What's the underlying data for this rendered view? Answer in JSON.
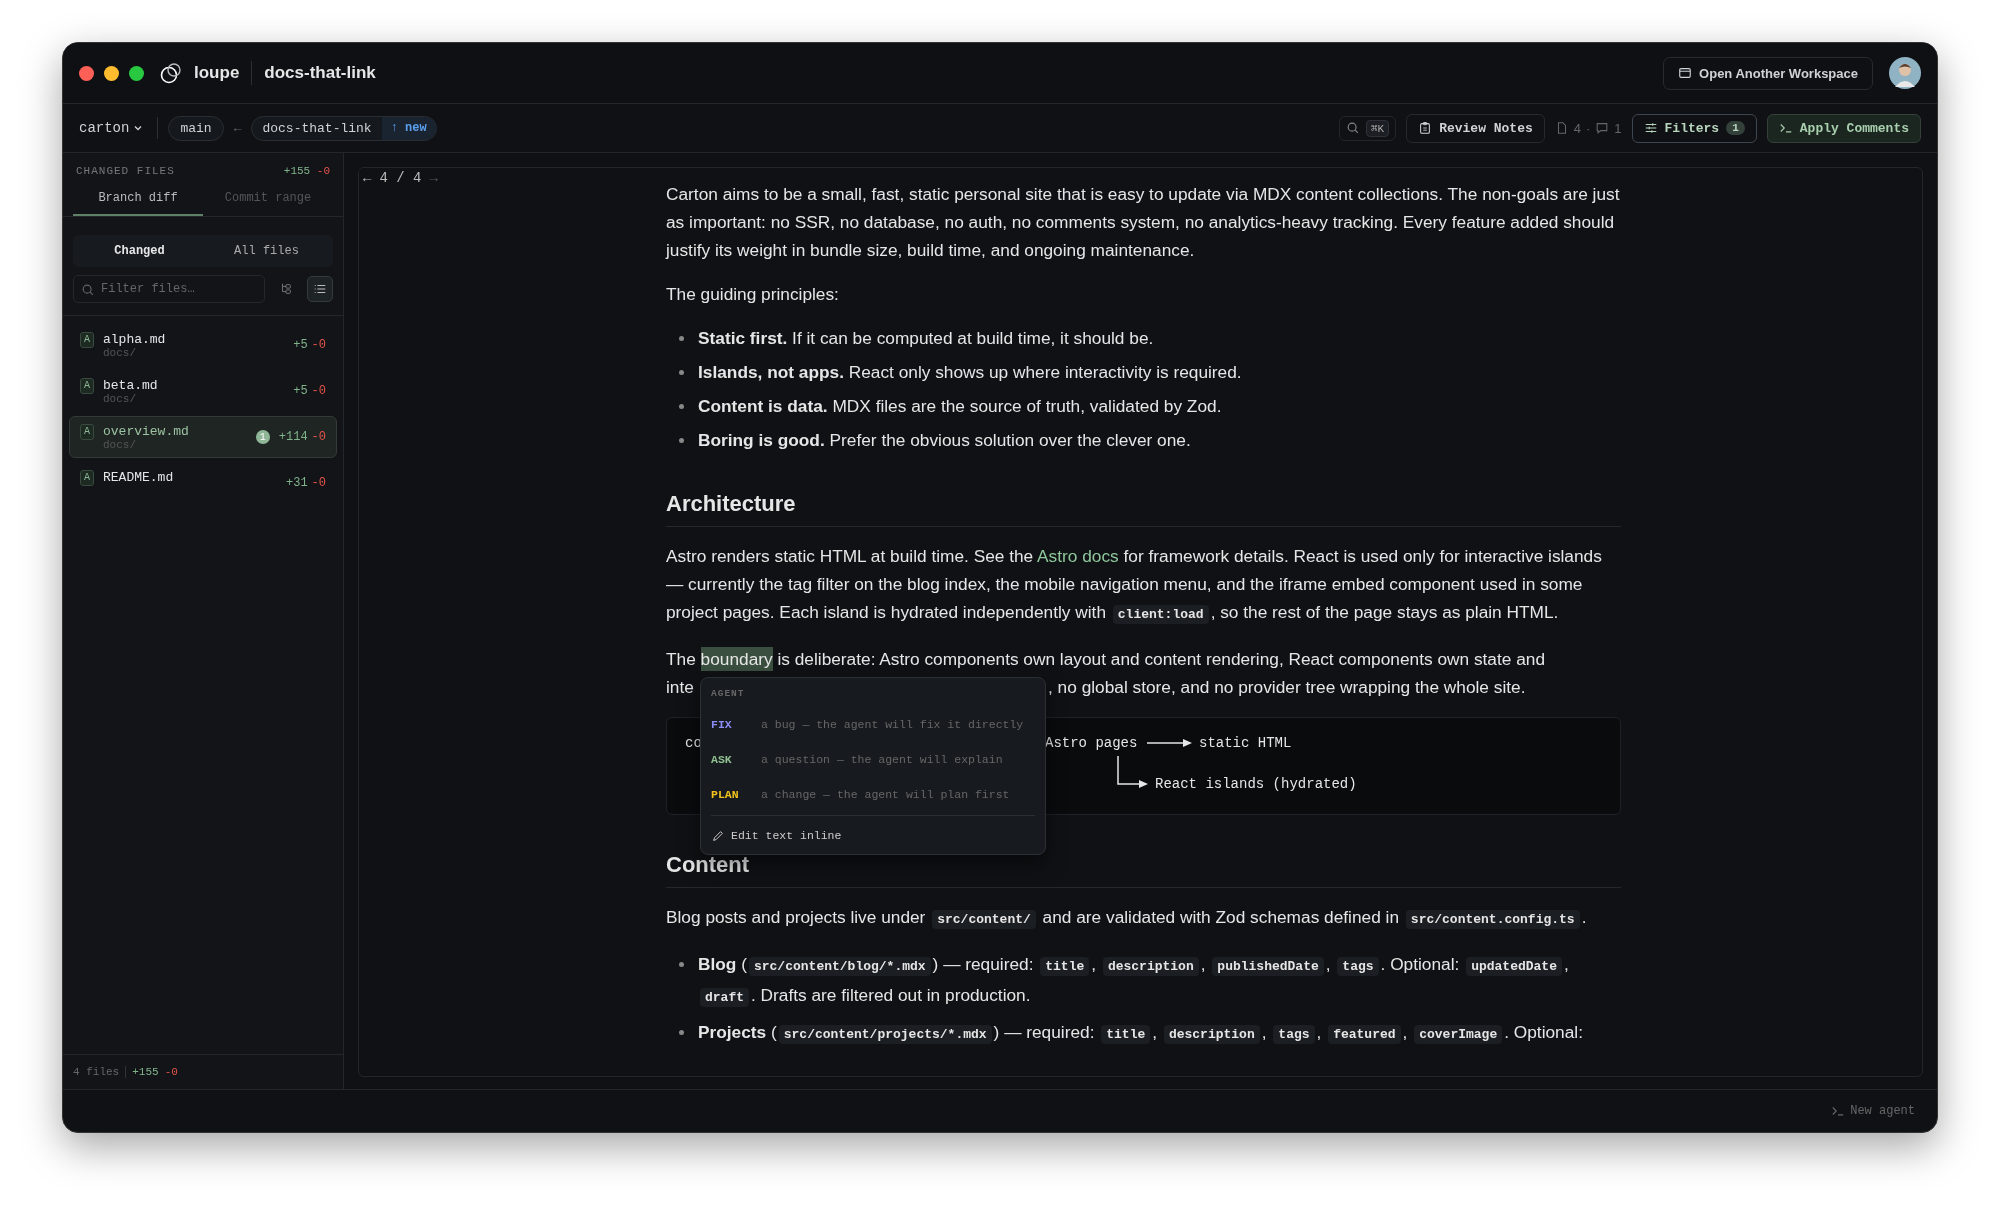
{
  "window": {
    "app_name": "loupe",
    "title": "docs-that-link",
    "open_workspace_button": "Open Another Workspace"
  },
  "toolbar": {
    "repo": "carton",
    "base_branch": "main",
    "arrow": "←",
    "branch": "docs-that-link",
    "branch_badge": "↑ new",
    "shortcut": "⌘K",
    "review_notes": "Review Notes",
    "file_count": "4",
    "separator": "·",
    "comment_count": "1",
    "filters": "Filters",
    "filters_count": "1",
    "apply": "Apply Comments"
  },
  "sidebar": {
    "heading": "CHANGED FILES",
    "added": "+155",
    "removed": "-0",
    "tabs": [
      {
        "label": "Branch diff",
        "selected": true
      },
      {
        "label": "Commit range",
        "selected": false
      }
    ],
    "segments": [
      {
        "label": "Changed",
        "selected": true
      },
      {
        "label": "All files",
        "selected": false
      }
    ],
    "filter_placeholder": "Filter files…",
    "files": [
      {
        "status": "A",
        "name": "alpha.md",
        "dir": "docs/",
        "added": "+5",
        "removed": "-0",
        "selected": false
      },
      {
        "status": "A",
        "name": "beta.md",
        "dir": "docs/",
        "added": "+5",
        "removed": "-0",
        "selected": false
      },
      {
        "status": "A",
        "name": "overview.md",
        "dir": "docs/",
        "comments": "1",
        "added": "+114",
        "removed": "-0",
        "selected": true
      },
      {
        "status": "A",
        "name": "README.md",
        "added": "+31",
        "removed": "-0",
        "selected": false
      }
    ],
    "footer": {
      "count": "4 files",
      "added": "+155",
      "removed": "-0"
    }
  },
  "pager": {
    "prev": "←",
    "position": "4 / 4",
    "next": "→"
  },
  "document": [
    {
      "kind": "paragraph",
      "runs": [
        {
          "kind": "text",
          "text": "Carton aims to be a small, fast, static personal site that is easy to update via MDX content collections. The non-goals are just as important: no SSR, no database, no auth, no comments system, no analytics-heavy tracking. Every feature added should justify its weight in bundle size, build time, and ongoing maintenance."
        }
      ]
    },
    {
      "kind": "paragraph",
      "runs": [
        {
          "kind": "text",
          "text": "The guiding principles:"
        }
      ]
    },
    {
      "kind": "list",
      "items": [
        {
          "runs": [
            {
              "kind": "bold",
              "text": "Static first."
            },
            {
              "kind": "text",
              "text": " If it can be computed at build time, it should be."
            }
          ]
        },
        {
          "runs": [
            {
              "kind": "bold",
              "text": "Islands, not apps."
            },
            {
              "kind": "text",
              "text": " React only shows up where interactivity is required."
            }
          ]
        },
        {
          "runs": [
            {
              "kind": "bold",
              "text": "Content is data."
            },
            {
              "kind": "text",
              "text": " MDX files are the source of truth, validated by Zod."
            }
          ]
        },
        {
          "runs": [
            {
              "kind": "bold",
              "text": "Boring is good."
            },
            {
              "kind": "text",
              "text": " Prefer the obvious solution over the clever one."
            }
          ]
        }
      ]
    },
    {
      "kind": "heading",
      "text": "Architecture"
    },
    {
      "kind": "paragraph",
      "runs": [
        {
          "kind": "text",
          "text": "Astro renders static HTML at build time. See the "
        },
        {
          "kind": "link",
          "text": "Astro docs"
        },
        {
          "kind": "text",
          "text": " for framework details. React is used only for interactive islands — currently the tag filter on the blog index, the mobile navigation menu, and the iframe embed component used in some project pages. Each island is hydrated independently with "
        },
        {
          "kind": "code",
          "text": "client:load"
        },
        {
          "kind": "text",
          "text": ", so the rest of the page stays as plain HTML."
        }
      ]
    },
    {
      "kind": "annotated",
      "line1": [
        {
          "kind": "text",
          "text": "The "
        },
        {
          "kind": "highlight",
          "text": "boundary"
        },
        {
          "kind": "text",
          "text": " is deliberate: Astro components own layout and content rendering, React components own state and"
        }
      ],
      "line2_start": "inte",
      "line2_end": ", no global store, and no provider tree wrapping the whole site."
    },
    {
      "kind": "diagram",
      "left": "co",
      "source": "Astro pages",
      "target": "static HTML",
      "branch": "React islands (hydrated)"
    },
    {
      "kind": "heading",
      "text": "Content"
    },
    {
      "kind": "paragraph",
      "runs": [
        {
          "kind": "text",
          "text": "Blog posts and projects live under "
        },
        {
          "kind": "code",
          "text": "src/content/"
        },
        {
          "kind": "text",
          "text": " and are validated with Zod schemas defined in "
        },
        {
          "kind": "code",
          "text": "src/content.config.ts"
        },
        {
          "kind": "text",
          "text": "."
        }
      ]
    },
    {
      "kind": "list",
      "items": [
        {
          "runs": [
            {
              "kind": "bold",
              "text": "Blog"
            },
            {
              "kind": "text",
              "text": " ("
            },
            {
              "kind": "code",
              "text": "src/content/blog/*.mdx"
            },
            {
              "kind": "text",
              "text": ") — required: "
            },
            {
              "kind": "code",
              "text": "title"
            },
            {
              "kind": "text",
              "text": ", "
            },
            {
              "kind": "code",
              "text": "description"
            },
            {
              "kind": "text",
              "text": ", "
            },
            {
              "kind": "code",
              "text": "publishedDate"
            },
            {
              "kind": "text",
              "text": ", "
            },
            {
              "kind": "code",
              "text": "tags"
            },
            {
              "kind": "text",
              "text": ". Optional: "
            },
            {
              "kind": "code",
              "text": "updatedDate"
            },
            {
              "kind": "text",
              "text": ", "
            },
            {
              "kind": "code",
              "text": "draft"
            },
            {
              "kind": "text",
              "text": ". Drafts are filtered out in production."
            }
          ]
        },
        {
          "runs": [
            {
              "kind": "bold",
              "text": "Projects"
            },
            {
              "kind": "text",
              "text": " ("
            },
            {
              "kind": "code",
              "text": "src/content/projects/*.mdx"
            },
            {
              "kind": "text",
              "text": ") — required: "
            },
            {
              "kind": "code",
              "text": "title"
            },
            {
              "kind": "text",
              "text": ", "
            },
            {
              "kind": "code",
              "text": "description"
            },
            {
              "kind": "text",
              "text": ", "
            },
            {
              "kind": "code",
              "text": "tags"
            },
            {
              "kind": "text",
              "text": ", "
            },
            {
              "kind": "code",
              "text": "featured"
            },
            {
              "kind": "text",
              "text": ", "
            },
            {
              "kind": "code",
              "text": "coverImage"
            },
            {
              "kind": "text",
              "text": ". Optional:"
            }
          ]
        }
      ]
    }
  ],
  "popup": {
    "heading": "AGENT",
    "options": [
      {
        "tag": "FIX",
        "text": "a bug — the agent will fix it directly",
        "color": "#8b8cf6"
      },
      {
        "tag": "ASK",
        "text": "a question — the agent will explain",
        "color": "#8fbf8f"
      },
      {
        "tag": "PLAN",
        "text": "a change — the agent will plan first",
        "color": "#f2c41b"
      }
    ],
    "edit": "Edit text inline"
  },
  "status_bar": {
    "new_agent": "New agent"
  }
}
